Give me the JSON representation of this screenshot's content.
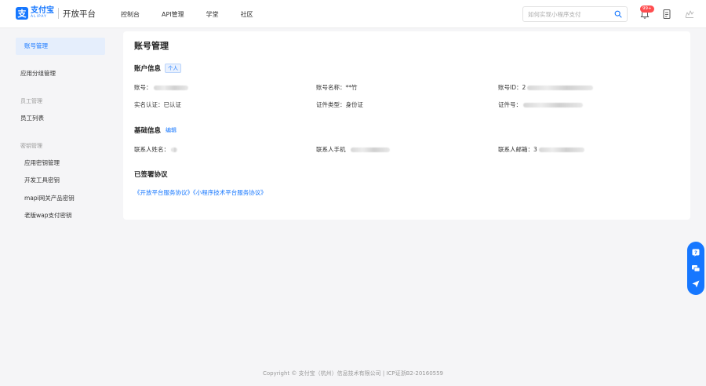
{
  "header": {
    "logo_cn": "支付宝",
    "logo_en": "ALIPAY",
    "title": "开放平台",
    "nav": [
      "控制台",
      "API管理",
      "学堂",
      "社区"
    ],
    "search_placeholder": "如何实现小程序支付",
    "notification_badge": "99+"
  },
  "sidebar": {
    "account_mgmt": "账号管理",
    "app_group_mgmt": "应用分组管理",
    "staff_group": "员工管理",
    "staff_list": "员工列表",
    "key_group": "密钥管理",
    "app_key": "应用密钥管理",
    "devtool_key": "开发工具密钥",
    "mapi_key": "mapi网关产品密钥",
    "wap_key": "老版wap支付密钥"
  },
  "main": {
    "title": "账号管理",
    "account_info": {
      "heading": "账户信息",
      "tag": "个人",
      "account_label": "账号：",
      "account_name_label": "账号名称：",
      "account_name_value": "**竹",
      "account_id_label": "账号ID：",
      "account_id_prefix": "2",
      "realname_label": "实名认证：",
      "realname_value": "已认证",
      "cert_type_label": "证件类型：",
      "cert_type_value": "身份证",
      "cert_no_label": "证件号："
    },
    "basic_info": {
      "heading": "基础信息",
      "edit": "编辑",
      "contact_name_label": "联系人姓名：",
      "contact_phone_label": "联系人手机",
      "contact_email_label": "联系人邮箱：",
      "contact_email_prefix": "3"
    },
    "agreements": {
      "heading": "已签署协议",
      "items": [
        "《开放平台服务协议》",
        "《小程序技术平台服务协议》"
      ]
    }
  },
  "footer": {
    "copyright": "Copyright © 支付宝（杭州）信息技术有限公司 | ICP证浙B2-20160559"
  },
  "colors": {
    "brand": "#1677ff",
    "badge": "#ff4d4f"
  }
}
